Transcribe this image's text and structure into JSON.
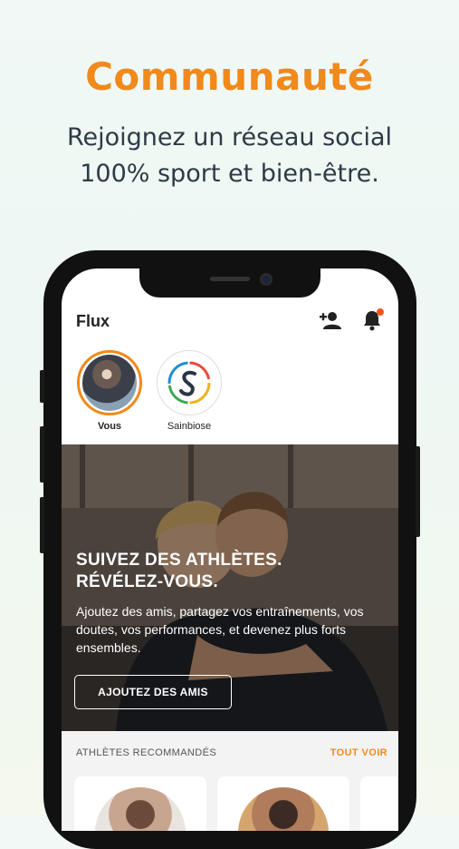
{
  "hero": {
    "title": "Communauté",
    "subtitle_line1": "Rejoignez un réseau social",
    "subtitle_line2": "100% sport et bien-être."
  },
  "app": {
    "header": {
      "title": "Flux"
    },
    "stories": [
      {
        "label": "Vous"
      },
      {
        "label": "Sainbiose"
      }
    ],
    "banner": {
      "title_line1": "SUIVEZ DES ATHLÈTES.",
      "title_line2": "RÉVÉLEZ-VOUS.",
      "text": "Ajoutez des amis, partagez vos entraînements, vos doutes, vos performances, et devenez plus forts ensembles.",
      "button": "AJOUTEZ DES AMIS"
    },
    "recommended": {
      "title": "ATHLÈTES RECOMMANDÉS",
      "see_all": "TOUT VOIR"
    }
  },
  "colors": {
    "accent": "#f08a1c",
    "text_dark": "#2d3b45",
    "notification": "#f0561c"
  }
}
